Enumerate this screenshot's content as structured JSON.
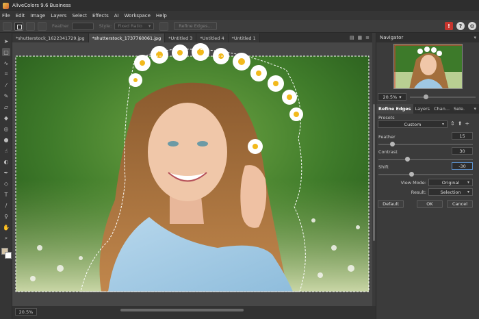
{
  "app": {
    "title": "AliveColors 9.6 Business"
  },
  "menu": [
    "File",
    "Edit",
    "Image",
    "Layers",
    "Select",
    "Effects",
    "AI",
    "Workspace",
    "Help"
  ],
  "options": {
    "feather_label": "Feather",
    "style_label": "Style:",
    "style_value": "Fixed Ratio",
    "refine_edges_label": "Refine Edges..."
  },
  "tabs": [
    "*shutterstock_1622341729.jpg",
    "*shutterstock_1737760061.jpg",
    "*Untitled 3",
    "*Untitled 4",
    "*Untitled 1"
  ],
  "active_tab_index": 1,
  "status": {
    "zoom": "20.5%"
  },
  "navigator": {
    "title": "Navigator",
    "zoom": "20.5%"
  },
  "panel_tabs": [
    "Refine Edges",
    "Layers",
    "Chan...",
    "Sele."
  ],
  "refine": {
    "presets_label": "Presets",
    "preset_value": "Custom",
    "feather_label": "Feather",
    "feather_value": "15",
    "contrast_label": "Contrast",
    "contrast_value": "30",
    "shift_label": "Shift",
    "shift_value": "-30",
    "view_mode_label": "View Mode:",
    "view_mode_value": "Original",
    "result_label": "Result:",
    "result_value": "Selection",
    "default_button": "Default",
    "ok_button": "OK",
    "cancel_button": "Cancel"
  },
  "icons": [
    "marquee-icon",
    "lasso-icon",
    "crop-icon",
    "brush-icon",
    "eraser-icon",
    "text-icon",
    "hand-icon",
    "zoom-icon"
  ],
  "colors": {
    "accent": "#5b8fc9",
    "foreground_swatch": "#d4c4a8",
    "background_swatch": "#ffffff"
  }
}
